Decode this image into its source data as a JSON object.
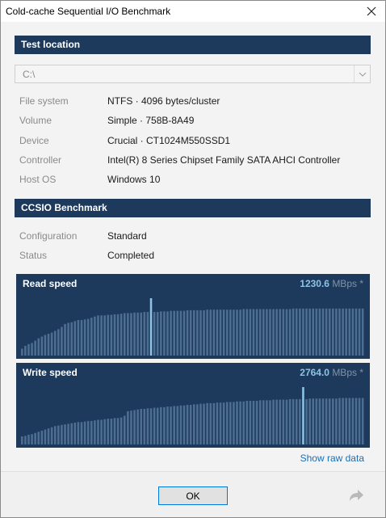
{
  "window": {
    "title": "Cold-cache Sequential I/O Benchmark"
  },
  "icons": {
    "close": "close-icon",
    "combo": "chevron-down-icon",
    "share": "share-arrow-icon"
  },
  "test_location": {
    "header": "Test location",
    "drive": "C:\\",
    "rows": [
      {
        "label": "File system",
        "value": "NTFS  ·  4096 bytes/cluster"
      },
      {
        "label": "Volume",
        "value": "Simple  ·  758B-8A49"
      },
      {
        "label": "Device",
        "value": "Crucial  ·  CT1024M550SSD1"
      },
      {
        "label": "Controller",
        "value": "Intel(R) 8 Series Chipset Family SATA AHCI Controller"
      },
      {
        "label": "Host OS",
        "value": "Windows 10"
      }
    ]
  },
  "benchmark": {
    "header": "CCSIO Benchmark",
    "rows": [
      {
        "label": "Configuration",
        "value": "Standard"
      },
      {
        "label": "Status",
        "value": "Completed"
      }
    ]
  },
  "colors": {
    "panel": "#1d3a5c",
    "bar": "#4e6e91",
    "highlight": "#8ec3e6",
    "value_text": "#8ec3e6"
  },
  "chart_data": [
    {
      "type": "bar",
      "title": "Read speed",
      "value": "1230.6",
      "unit": "MBps *",
      "max": 1,
      "highlight_index": 39,
      "values": [
        0.12,
        0.17,
        0.2,
        0.22,
        0.26,
        0.3,
        0.33,
        0.36,
        0.38,
        0.4,
        0.43,
        0.46,
        0.5,
        0.55,
        0.57,
        0.58,
        0.6,
        0.62,
        0.62,
        0.63,
        0.64,
        0.66,
        0.68,
        0.7,
        0.7,
        0.7,
        0.71,
        0.71,
        0.72,
        0.72,
        0.73,
        0.74,
        0.74,
        0.74,
        0.75,
        0.75,
        0.75,
        0.76,
        0.76,
        1.0,
        0.76,
        0.76,
        0.77,
        0.77,
        0.77,
        0.78,
        0.78,
        0.78,
        0.78,
        0.78,
        0.79,
        0.79,
        0.79,
        0.79,
        0.79,
        0.79,
        0.8,
        0.8,
        0.8,
        0.8,
        0.8,
        0.8,
        0.8,
        0.8,
        0.8,
        0.8,
        0.8,
        0.81,
        0.81,
        0.81,
        0.81,
        0.81,
        0.81,
        0.81,
        0.81,
        0.81,
        0.81,
        0.81,
        0.81,
        0.81,
        0.81,
        0.81,
        0.82,
        0.82,
        0.82,
        0.82,
        0.82,
        0.82,
        0.82,
        0.82,
        0.82,
        0.82,
        0.82,
        0.82,
        0.82,
        0.82,
        0.82,
        0.82,
        0.82,
        0.82,
        0.82,
        0.82,
        0.82,
        0.82
      ]
    },
    {
      "type": "bar",
      "title": "Write speed",
      "value": "2764.0",
      "unit": "MBps *",
      "max": 1,
      "highlight_index": 85,
      "values": [
        0.14,
        0.15,
        0.17,
        0.18,
        0.2,
        0.22,
        0.24,
        0.26,
        0.28,
        0.3,
        0.32,
        0.33,
        0.34,
        0.35,
        0.36,
        0.37,
        0.38,
        0.39,
        0.39,
        0.4,
        0.41,
        0.41,
        0.42,
        0.43,
        0.43,
        0.44,
        0.45,
        0.45,
        0.46,
        0.46,
        0.47,
        0.5,
        0.58,
        0.59,
        0.6,
        0.61,
        0.62,
        0.62,
        0.63,
        0.63,
        0.64,
        0.64,
        0.65,
        0.65,
        0.66,
        0.66,
        0.67,
        0.67,
        0.68,
        0.68,
        0.69,
        0.69,
        0.7,
        0.7,
        0.71,
        0.71,
        0.72,
        0.72,
        0.72,
        0.73,
        0.73,
        0.73,
        0.74,
        0.74,
        0.74,
        0.75,
        0.75,
        0.75,
        0.76,
        0.76,
        0.76,
        0.76,
        0.77,
        0.77,
        0.77,
        0.77,
        0.78,
        0.78,
        0.78,
        0.78,
        0.78,
        0.79,
        0.79,
        0.79,
        0.79,
        1.0,
        0.79,
        0.8,
        0.8,
        0.8,
        0.8,
        0.8,
        0.8,
        0.8,
        0.8,
        0.8,
        0.81,
        0.81,
        0.81,
        0.81,
        0.81,
        0.81,
        0.81,
        0.81
      ]
    }
  ],
  "links": {
    "raw_data": "Show raw data"
  },
  "buttons": {
    "ok": "OK"
  }
}
